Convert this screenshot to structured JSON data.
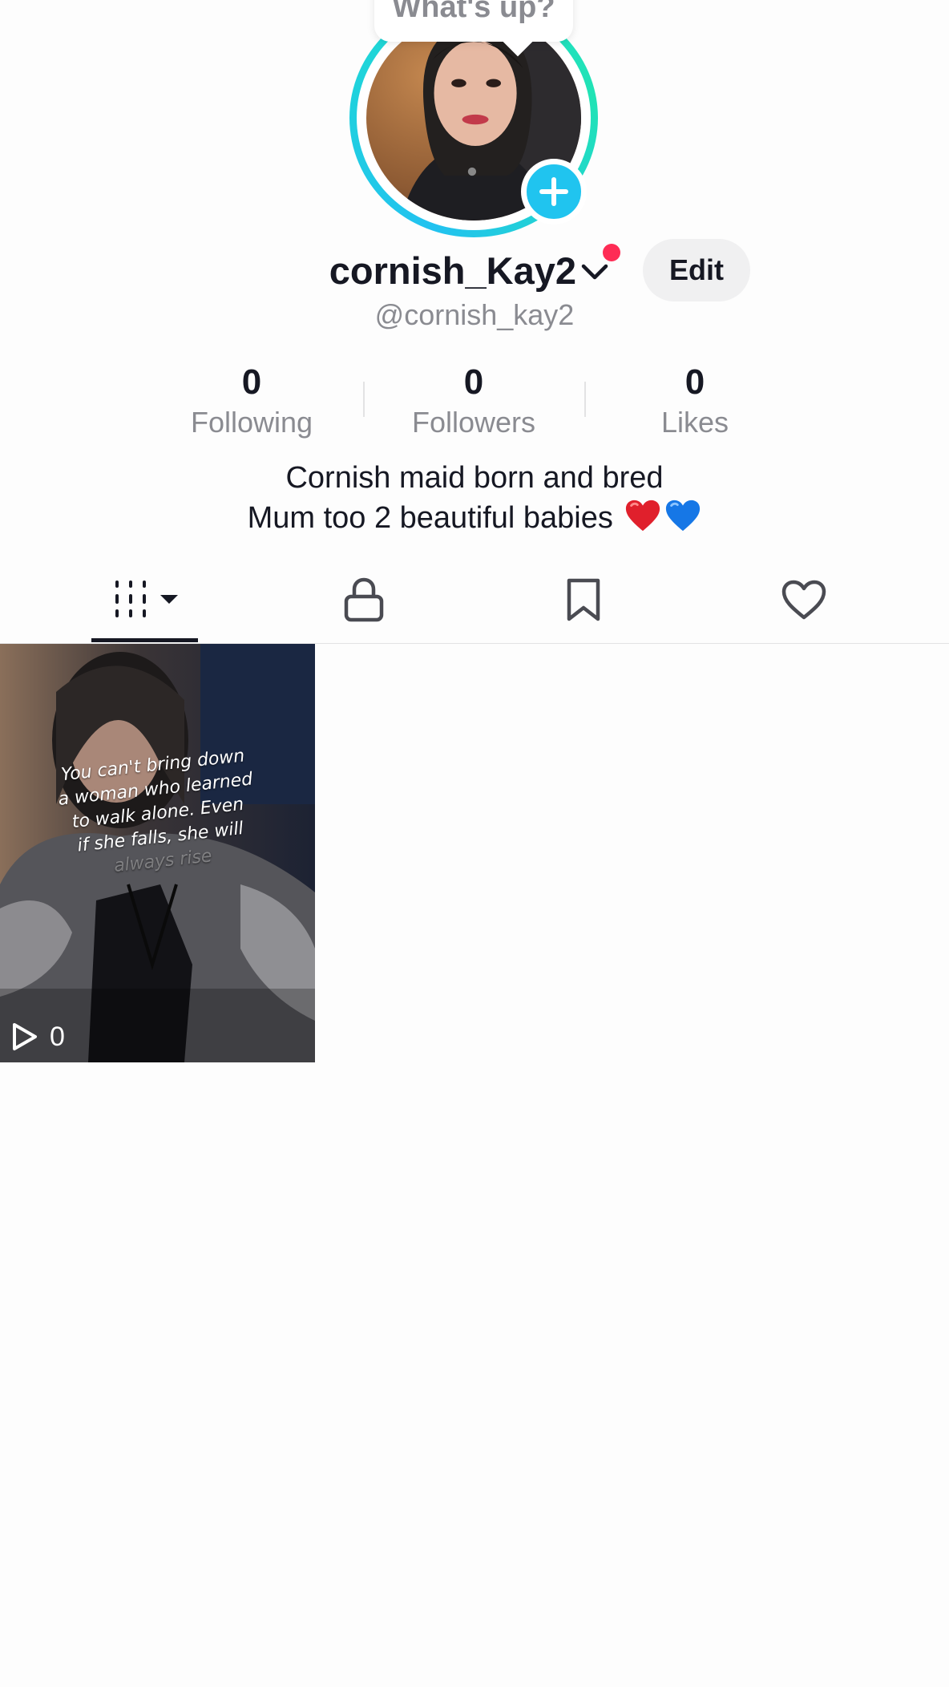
{
  "status_bubble": {
    "text": "What's up?"
  },
  "profile": {
    "display_name": "cornish_Kay2",
    "handle": "@cornish_kay2",
    "edit_label": "Edit",
    "notification_dot": true
  },
  "stats": [
    {
      "key": "following",
      "value": "0",
      "label": "Following"
    },
    {
      "key": "followers",
      "value": "0",
      "label": "Followers"
    },
    {
      "key": "likes",
      "value": "0",
      "label": "Likes"
    }
  ],
  "bio": {
    "line1": "Cornish maid born and bred",
    "line2": "Mum too 2 beautiful babies",
    "emojis": [
      "red-heart",
      "blue-heart"
    ]
  },
  "tabs": [
    {
      "name": "videos",
      "icon": "grid-icon",
      "active": true
    },
    {
      "name": "private",
      "icon": "lock-icon",
      "active": false
    },
    {
      "name": "saved",
      "icon": "bookmark-icon",
      "active": false
    },
    {
      "name": "liked",
      "icon": "heart-outline-icon",
      "active": false
    }
  ],
  "videos": [
    {
      "caption_lines": [
        "You can't bring down",
        "a woman who learned",
        "to walk alone. Even",
        "if she falls, she will",
        "always rise"
      ],
      "play_count": "0"
    }
  ],
  "colors": {
    "accent_pink": "#fe2c55",
    "ring_cyan": "#22c2f0",
    "ring_green": "#21e3b5",
    "text_primary": "#161823",
    "text_secondary": "#8a8b91"
  }
}
